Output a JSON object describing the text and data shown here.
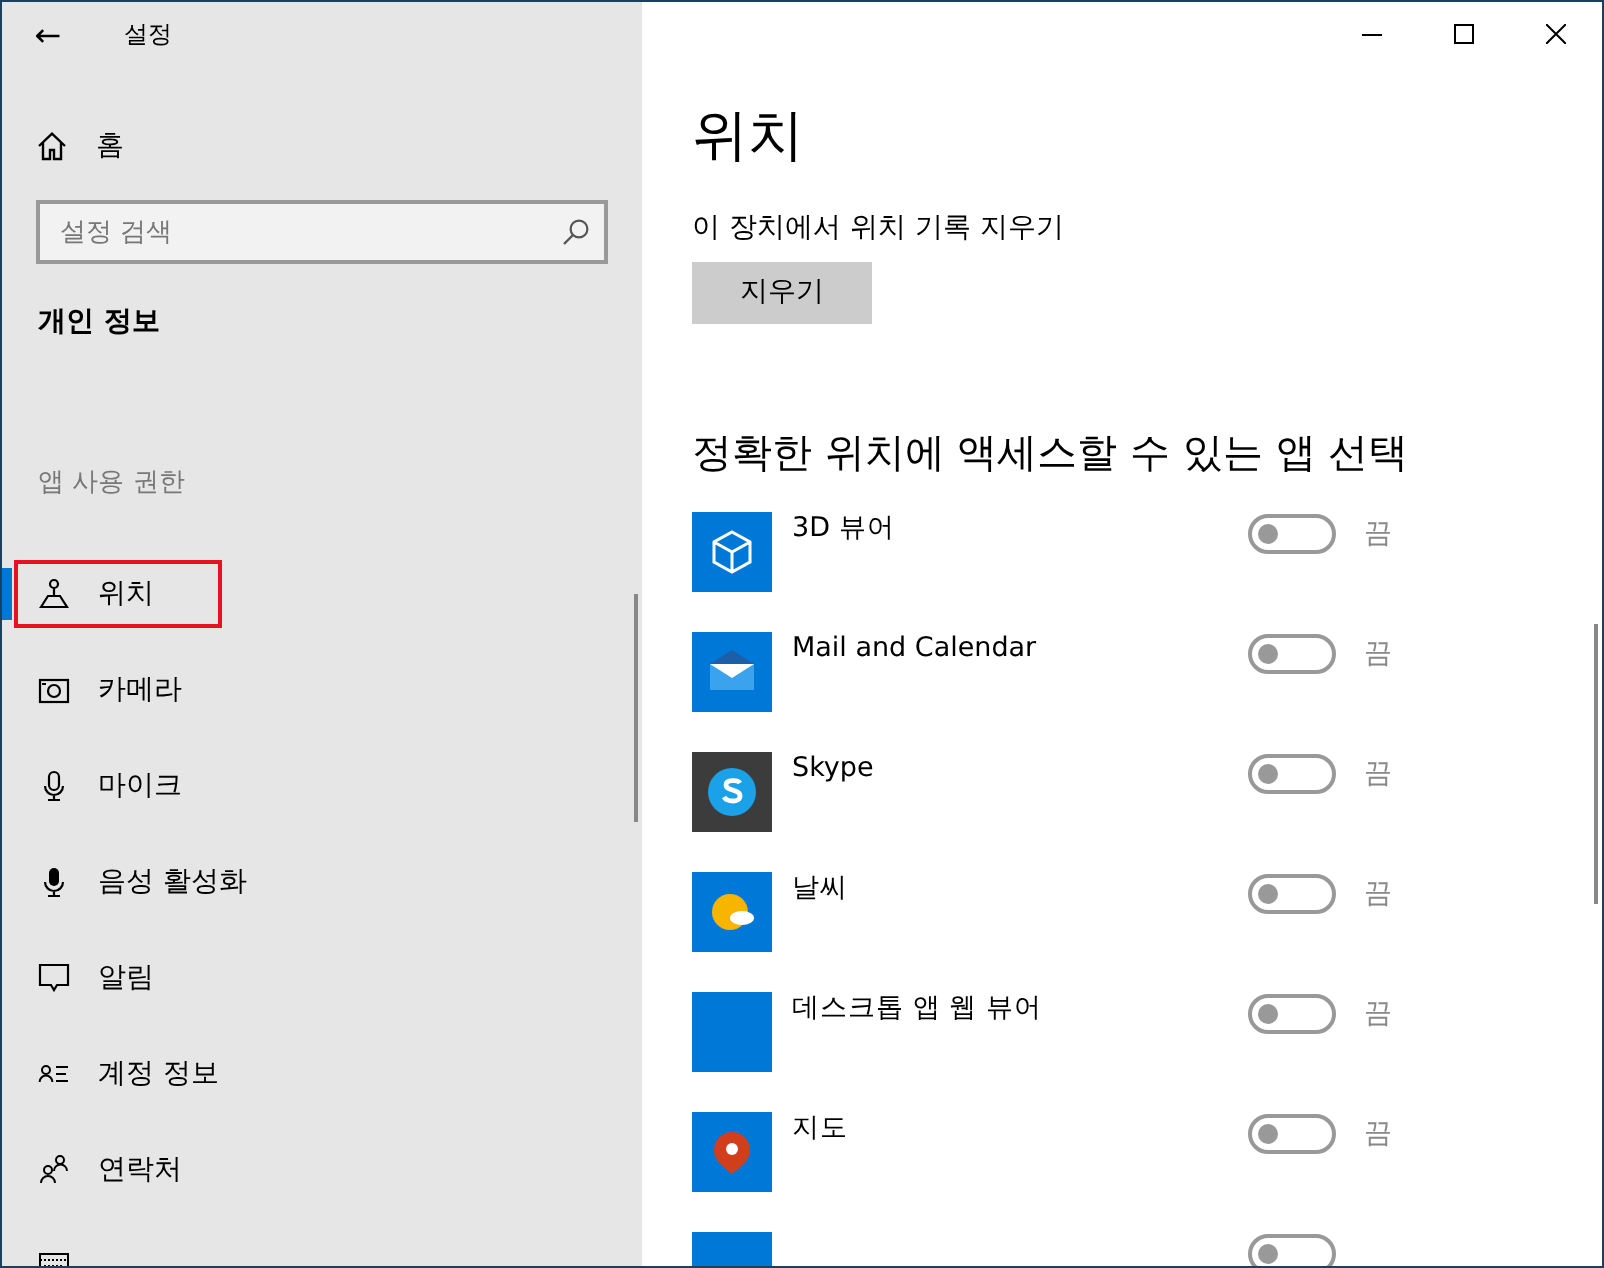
{
  "window": {
    "title": "설정",
    "back": "←"
  },
  "sidebar": {
    "home": "홈",
    "search": {
      "placeholder": "설정 검색"
    },
    "section": "개인 정보",
    "group": "앱 사용 권한",
    "items": [
      {
        "label": "위치",
        "selected": true
      },
      {
        "label": "카메라",
        "selected": false
      },
      {
        "label": "마이크",
        "selected": false
      },
      {
        "label": "음성 활성화",
        "selected": false
      },
      {
        "label": "알림",
        "selected": false
      },
      {
        "label": "계정 정보",
        "selected": false
      },
      {
        "label": "연락처",
        "selected": false
      },
      {
        "selected": false
      }
    ]
  },
  "main": {
    "title": "위치",
    "clear_label": "이 장치에서 위치 기록 지우기",
    "clear_button": "지우기",
    "apps_heading": "정확한 위치에 액세스할 수 있는 앱 선택",
    "apps": [
      {
        "name": "3D 뷰어",
        "on": false,
        "state": "끔"
      },
      {
        "name": "Mail and Calendar",
        "on": false,
        "state": "끔"
      },
      {
        "name": "Skype",
        "on": false,
        "state": "끔"
      },
      {
        "name": "날씨",
        "on": false,
        "state": "끔"
      },
      {
        "name": "데스크톱 앱 웹 뷰어",
        "on": false,
        "state": "끔"
      },
      {
        "name": "지도",
        "on": false,
        "state": "끔"
      },
      {
        "on": false
      }
    ]
  }
}
